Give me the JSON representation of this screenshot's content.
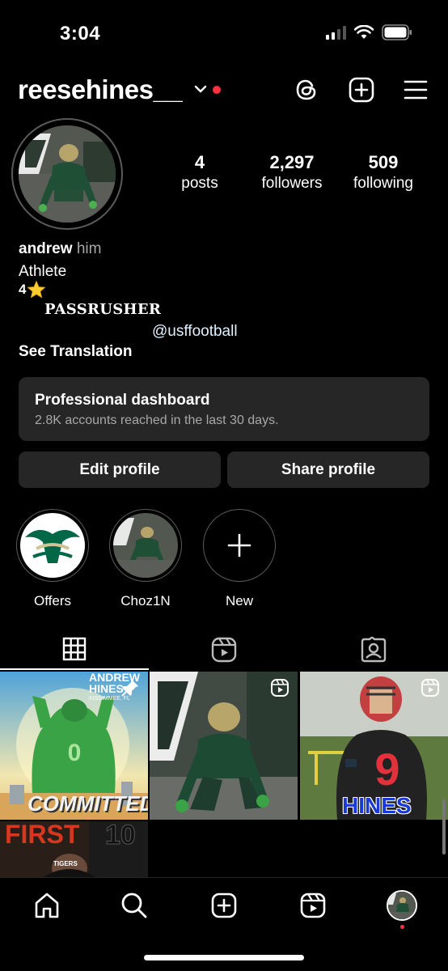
{
  "status_bar": {
    "time": "3:04"
  },
  "header": {
    "username": "reesehines__"
  },
  "profile": {
    "posts_count": "4",
    "posts_label": "posts",
    "followers_count": "2,297",
    "followers_label": "followers",
    "following_count": "509",
    "following_label": "following"
  },
  "bio": {
    "name": "andrew",
    "pronouns": "him",
    "category": "Athlete",
    "rating": "4",
    "rating_icon": "star-emoji",
    "line_passrusher": "PASSRUSHER",
    "mention": "@usffootball",
    "see_translation": "See Translation"
  },
  "dashboard": {
    "title": "Professional dashboard",
    "subtitle": "2.8K accounts reached in the last 30 days."
  },
  "buttons": {
    "edit": "Edit profile",
    "share": "Share profile"
  },
  "highlights": [
    {
      "label": "Offers"
    },
    {
      "label": "Choz1N"
    },
    {
      "label": "New"
    }
  ],
  "posts": [
    {
      "overlay_top": "ANDREW HINES",
      "overlay_small": "KISSIMMEE, FL",
      "overlay_bottom": "COMMITTED",
      "type_icon": "pin-icon"
    },
    {
      "type_icon": "reel-icon"
    },
    {
      "overlay_bottom": "HINES",
      "type_icon": "reel-icon"
    },
    {
      "overlay_top": "FIRST",
      "overlay_right": "10",
      "overlay_small": "TIGERS"
    }
  ],
  "colors": {
    "background": "#000000",
    "card": "#262626",
    "notification": "#ff3040",
    "usf_green": "#006747",
    "usf_gold": "#cfc493"
  }
}
